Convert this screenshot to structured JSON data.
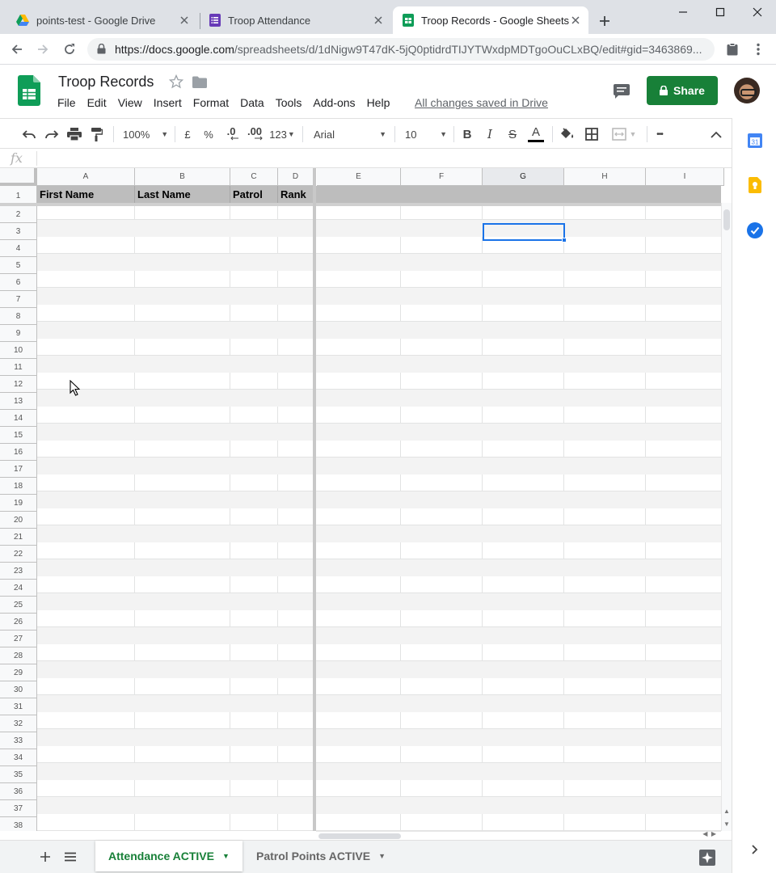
{
  "browser": {
    "tabs": [
      {
        "title": "points-test - Google Drive",
        "icon": "google-drive-icon"
      },
      {
        "title": "Troop Attendance",
        "icon": "google-forms-icon"
      },
      {
        "title": "Troop Records - Google Sheets",
        "icon": "google-sheets-icon",
        "active": true
      }
    ],
    "url_host": "https://docs.google.com",
    "url_path": "/spreadsheets/d/1dNigw9T47dK-5jQ0ptidrdTIJYTWxdpMDTgoOuCLxBQ/edit#gid=3463869..."
  },
  "doc": {
    "title": "Troop Records",
    "menu": [
      "File",
      "Edit",
      "View",
      "Insert",
      "Format",
      "Data",
      "Tools",
      "Add-ons",
      "Help"
    ],
    "save_status": "All changes saved in Drive",
    "share_label": "Share"
  },
  "toolbar": {
    "zoom": "100%",
    "currency": "£",
    "percent": "%",
    "decimal_decrease": ".0",
    "decimal_increase": ".00",
    "number_format": "123",
    "font": "Arial",
    "font_size": "10",
    "bold": "B",
    "italic": "I",
    "strike": "S",
    "text_color_glyph": "A",
    "more": "•••"
  },
  "formula": {
    "fx": "fx",
    "value": ""
  },
  "grid": {
    "columns": [
      "A",
      "B",
      "C",
      "D",
      "E",
      "F",
      "G",
      "H",
      "I"
    ],
    "selected_column": "G",
    "header_row": [
      "First Name",
      "Last Name",
      "Patrol",
      "Rank"
    ],
    "row_numbers": [
      "1",
      "2",
      "3",
      "4",
      "5",
      "6",
      "7",
      "8",
      "9",
      "10",
      "11",
      "12",
      "13",
      "14",
      "15",
      "16",
      "17",
      "18",
      "19",
      "20",
      "21",
      "22",
      "23",
      "24",
      "25",
      "26",
      "27",
      "28",
      "29",
      "30",
      "31",
      "32",
      "33",
      "34",
      "35",
      "36",
      "37",
      "38"
    ],
    "active_cell": "G3"
  },
  "sheets": [
    {
      "name": "Attendance ACTIVE",
      "active": true
    },
    {
      "name": "Patrol Points ACTIVE",
      "active": false
    }
  ],
  "colors": {
    "sheets_green": "#188038",
    "selection_blue": "#1a73e8",
    "header_gray": "#bdbdbd"
  }
}
